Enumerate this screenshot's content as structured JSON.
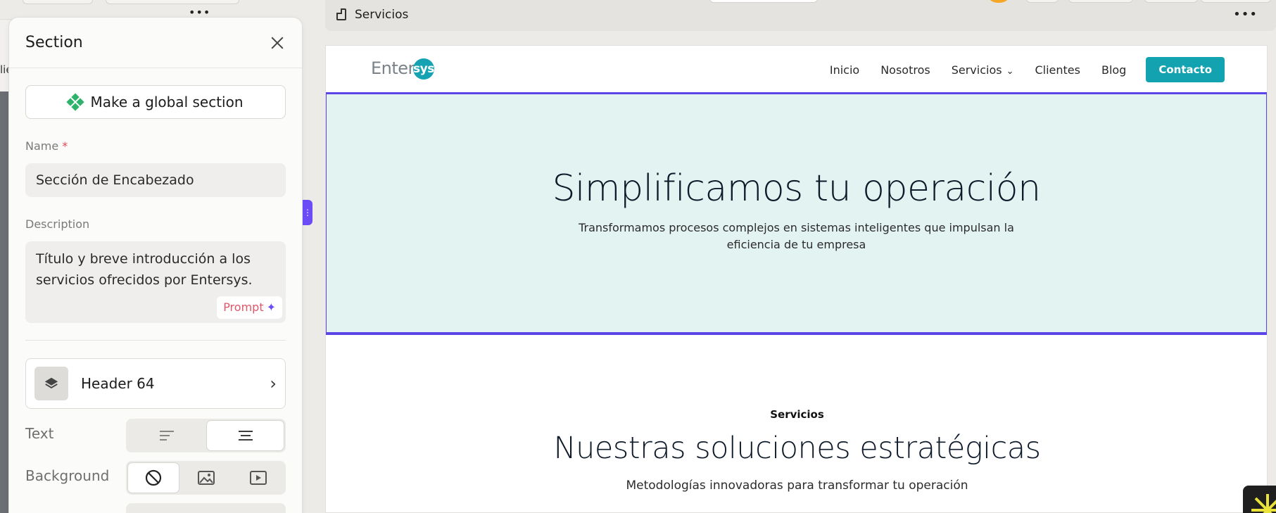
{
  "panel": {
    "title": "Section",
    "global_button_label": "Make a global section",
    "name_label": "Name",
    "name_required_mark": "*",
    "name_value": "Sección de Encabezado",
    "description_label": "Description",
    "description_value": "Título y breve introducción a los servicios ofrecidos por Entersys.",
    "prompt_label": "Prompt",
    "prompt_icon": "sparkle-icon",
    "layout_name": "Header 64",
    "text_label": "Text",
    "text_align_options": [
      "align-left-icon",
      "align-center-icon"
    ],
    "text_align_selected": "center",
    "background_label": "Background",
    "background_options": [
      "none-icon",
      "image-icon",
      "video-icon"
    ],
    "background_selected": "none"
  },
  "canvas": {
    "page_name": "Servicios",
    "more_icon": "more-horizontal-icon"
  },
  "site": {
    "logo_text": "Enter",
    "logo_badge": "sys",
    "nav": {
      "inicio": "Inicio",
      "nosotros": "Nosotros",
      "servicios": "Servicios",
      "clientes": "Clientes",
      "blog": "Blog",
      "contacto": "Contacto"
    },
    "hero": {
      "title": "Simplificamos tu operación",
      "subtitle": "Transformamos procesos complejos en sistemas inteligentes que impulsan la eficiencia de tu empresa"
    },
    "services": {
      "tagline": "Servicios",
      "title": "Nuestras soluciones estratégicas",
      "subtitle": "Metodologías innovadoras para transformar tu operación"
    }
  },
  "background": {
    "left_snippet": "lie"
  },
  "colors": {
    "accent": "#5b45e6",
    "brand": "#13a2b0",
    "hero_bg": "#e3f3f2",
    "global_icon": "#2fb36c"
  }
}
